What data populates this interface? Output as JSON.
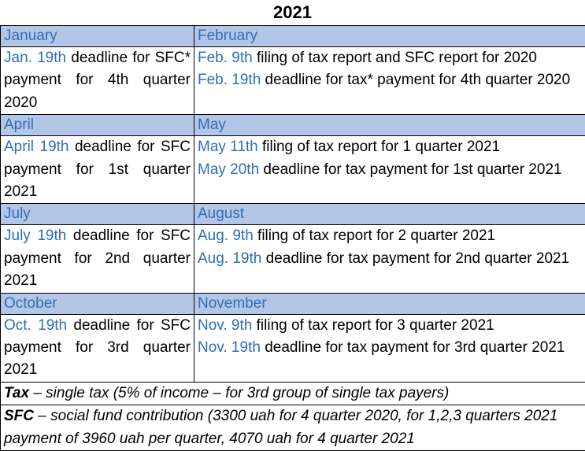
{
  "title": "2021",
  "quarters": [
    {
      "left_month": "January",
      "right_month": "February",
      "left": {
        "date": "Jan. 19th",
        "text": " deadline for SFC* payment for 4th quarter 2020"
      },
      "right": [
        {
          "date": "Feb. 9th",
          "text": " filing of tax report and SFC report for 2020"
        },
        {
          "date": "Feb. 19th",
          "text": " deadline for tax* payment for 4th quarter 2020"
        }
      ]
    },
    {
      "left_month": "April",
      "right_month": "May",
      "left": {
        "date": "April 19th",
        "text": " deadline for SFC payment for 1st quarter 2021"
      },
      "right": [
        {
          "date": "May 11th",
          "text": " filing of tax report for 1 quarter 2021"
        },
        {
          "date": "May 20th",
          "text": " deadline for tax payment for 1st quarter 2021"
        }
      ]
    },
    {
      "left_month": "July",
      "right_month": "August",
      "left": {
        "date": "July 19th",
        "text": " deadline for SFC payment for 2nd quarter 2021"
      },
      "right": [
        {
          "date": "Aug. 9th",
          "text": " filing of tax report for 2 quarter 2021"
        },
        {
          "date": "Aug. 19th",
          "text": " deadline for tax payment for 2nd quarter 2021"
        }
      ]
    },
    {
      "left_month": "October",
      "right_month": "November",
      "left": {
        "date": "Oct. 19th",
        "text": " deadline for SFC payment for 3rd quarter 2021"
      },
      "right": [
        {
          "date": "Nov. 9th",
          "text": " filing of tax report for 3 quarter 2021"
        },
        {
          "date": "Nov. 19th",
          "text": " deadline for tax payment for 3rd quarter 2021"
        }
      ]
    }
  ],
  "notes": {
    "tax_term": "Tax",
    "tax_text": " – single tax (5% of income – for 3rd group of single tax payers)",
    "sfc_term": "SFC",
    "sfc_text": " – social fund contribution (3300 uah for 4 quarter 2020,  for 1,2,3 quarters 2021 payment of 3960 uah per quarter, 4070 uah for 4 quarter 2021"
  },
  "colors": {
    "header_fill": "#b4c6e7",
    "accent_text": "#2f6eb5"
  }
}
